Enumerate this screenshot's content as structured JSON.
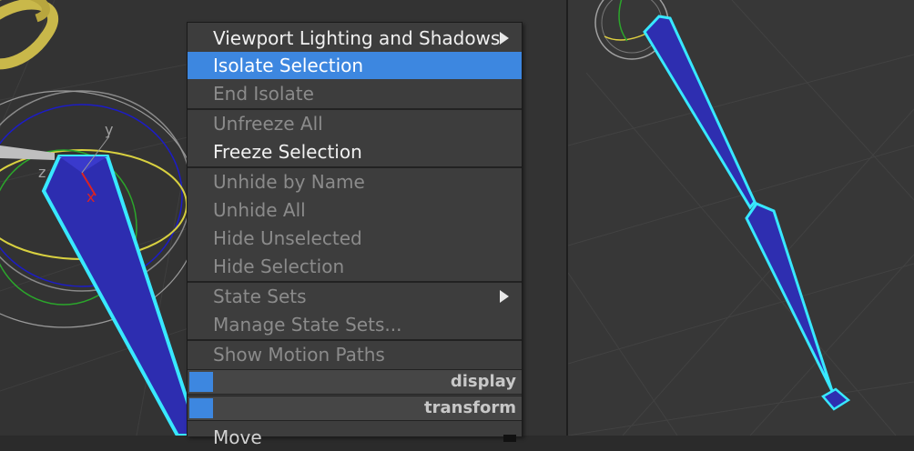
{
  "left_viewport": {
    "axis_labels": {
      "y": "y",
      "z": "z",
      "x": "x"
    }
  },
  "quad_menu": {
    "items": [
      {
        "label": "Viewport Lighting and Shadows",
        "state": "normal",
        "submenu": true
      },
      {
        "label": "Isolate Selection",
        "state": "highlighted"
      },
      {
        "label": "End Isolate",
        "state": "disabled"
      },
      {
        "label": "Unfreeze All",
        "state": "disabled"
      },
      {
        "label": "Freeze Selection",
        "state": "normal"
      },
      {
        "label": "Unhide by Name",
        "state": "disabled"
      },
      {
        "label": "Unhide All",
        "state": "disabled"
      },
      {
        "label": "Hide Unselected",
        "state": "disabled"
      },
      {
        "label": "Hide Selection",
        "state": "disabled"
      },
      {
        "label": "State Sets",
        "state": "disabled",
        "submenu": true
      },
      {
        "label": "Manage State Sets...",
        "state": "disabled"
      },
      {
        "label": "Show Motion Paths",
        "state": "disabled"
      },
      {
        "label": "Move",
        "state": "normal"
      }
    ],
    "quad_titles": {
      "display": "display",
      "transform": "transform"
    }
  },
  "colors": {
    "highlight": "#3d87e0",
    "bone_fill": "#2e2eb0",
    "bone_outline": "#38e8ff",
    "gizmo_yellow": "#e6e04a",
    "viewport_bg": "#333333"
  }
}
